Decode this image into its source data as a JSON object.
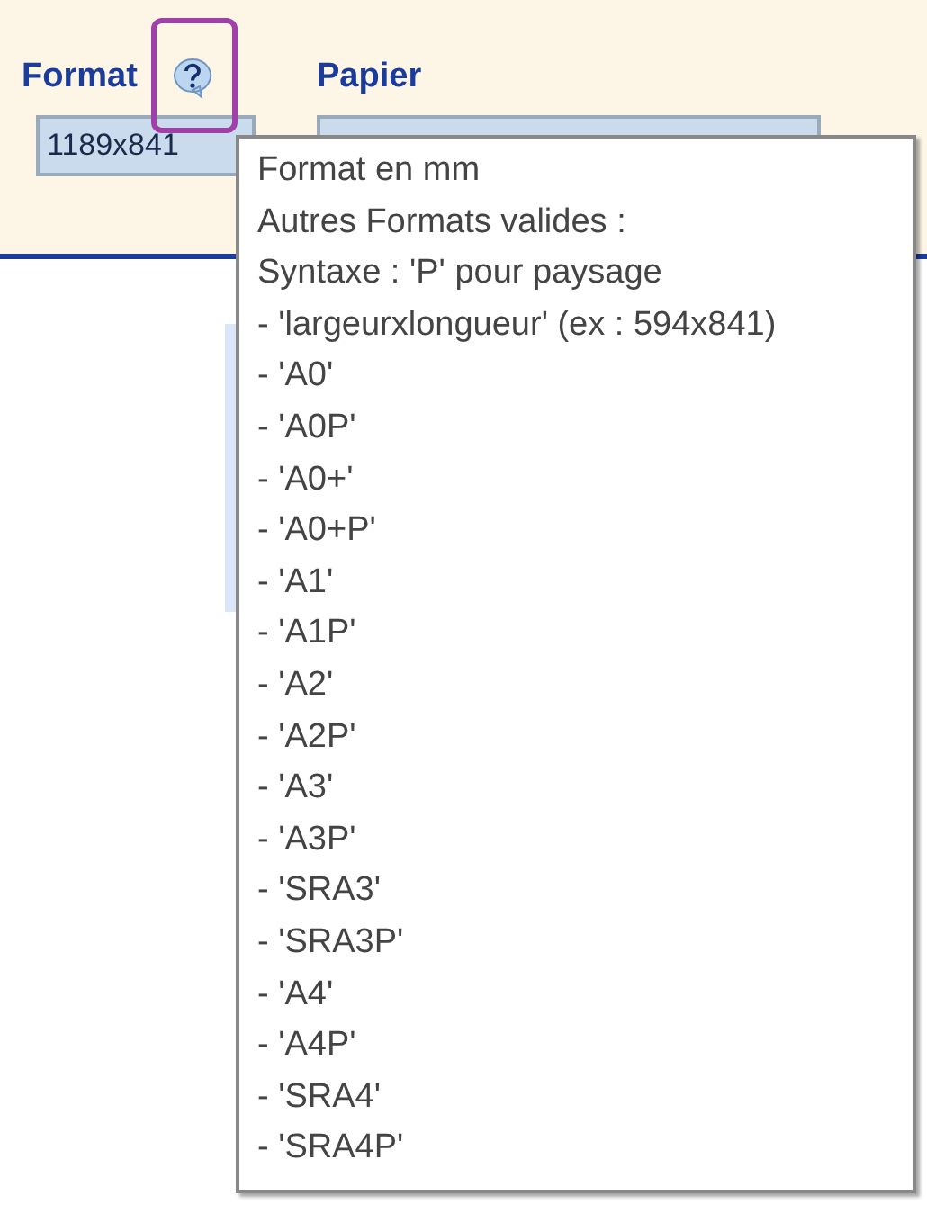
{
  "fields": [
    {
      "label": "Format",
      "help": true,
      "value": "1189x841"
    },
    {
      "label": "Papier",
      "help": false
    }
  ],
  "tooltip": {
    "lines": [
      "Format en mm",
      "Autres Formats valides :",
      "Syntaxe : 'P' pour paysage",
      "- 'largeurxlongueur' (ex : 594x841)",
      "- 'A0'",
      "- 'A0P'",
      "- 'A0+'",
      "- 'A0+P'",
      "- 'A1'",
      "- 'A1P'",
      "- 'A2'",
      "- 'A2P'",
      "- 'A3'",
      "- 'A3P'",
      "- 'SRA3'",
      "- 'SRA3P'",
      "- 'A4'",
      "- 'A4P'",
      "- 'SRA4'",
      "- 'SRA4P'"
    ]
  }
}
